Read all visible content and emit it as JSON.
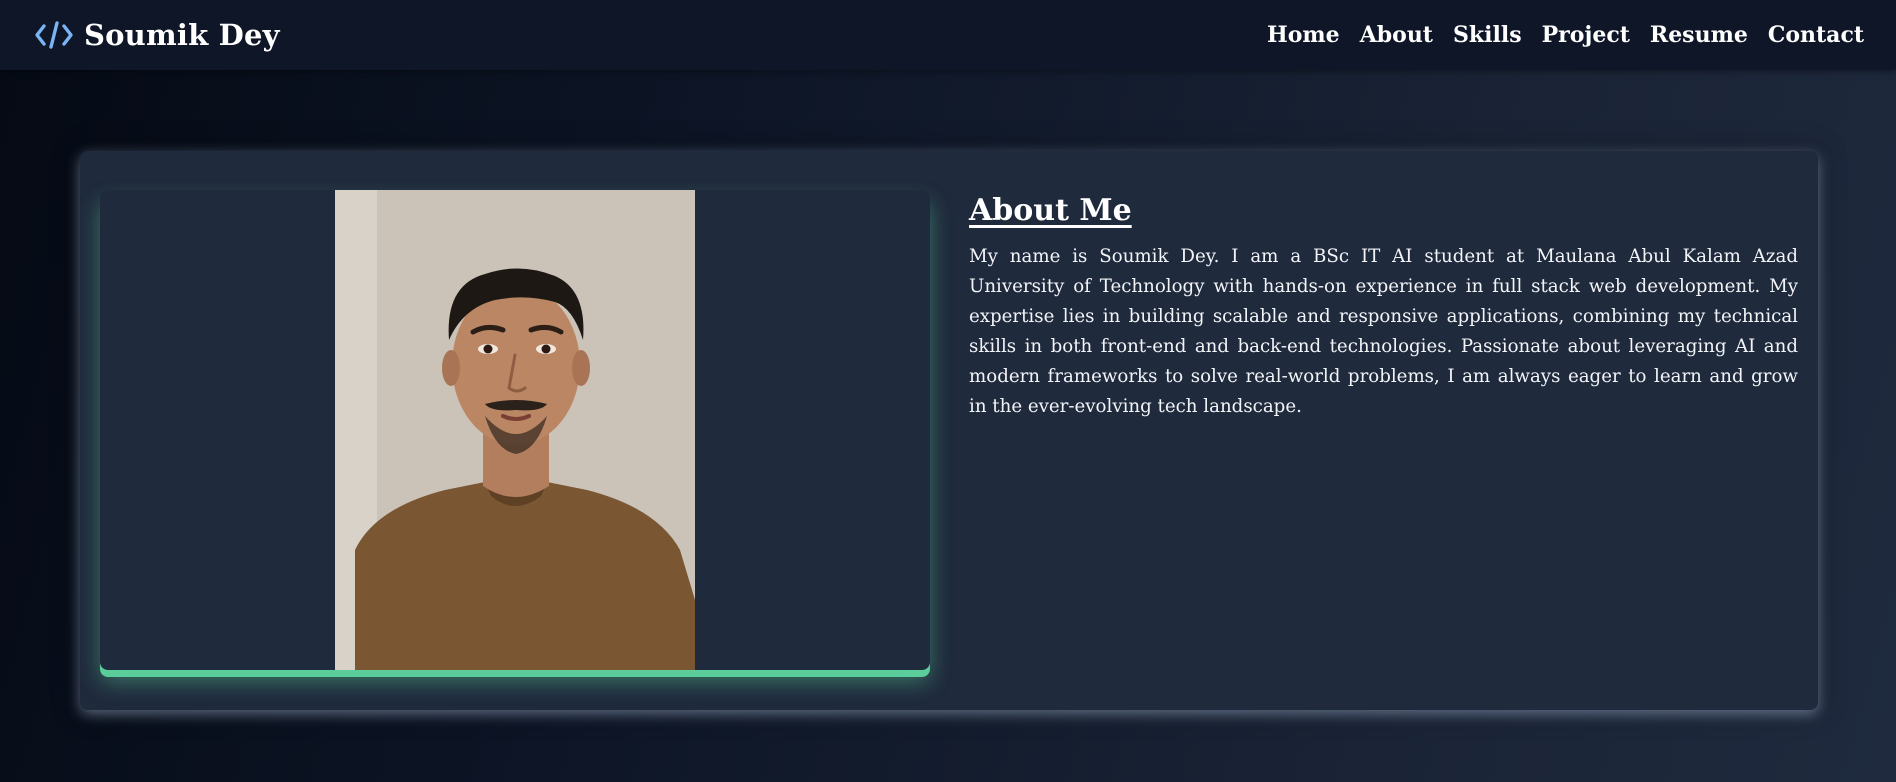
{
  "brand": {
    "name": "Soumik Dey",
    "icon": "code-brackets-icon",
    "icon_color": "#7ab4f5"
  },
  "nav": {
    "items": [
      {
        "label": "Home"
      },
      {
        "label": "About"
      },
      {
        "label": "Skills"
      },
      {
        "label": "Project"
      },
      {
        "label": "Resume"
      },
      {
        "label": "Contact"
      }
    ]
  },
  "about": {
    "title": "About Me",
    "body": "My name is Soumik Dey. I am a BSc IT AI student at Maulana Abul Kalam Azad University of Technology with hands-on experience in full stack web development. My expertise lies in building scalable and responsive applications, combining my technical skills in both front-end and back-end technologies. Passionate about leveraging AI and modern frameworks to solve real-world problems, I am always eager to learn and grow in the ever-evolving tech landscape.",
    "photo": "profile-photo",
    "accent_color": "#5bcd9a"
  },
  "colors": {
    "navbar_bg": "#0e1628",
    "card_bg": "#1f2a3c",
    "text": "#ffffff"
  }
}
